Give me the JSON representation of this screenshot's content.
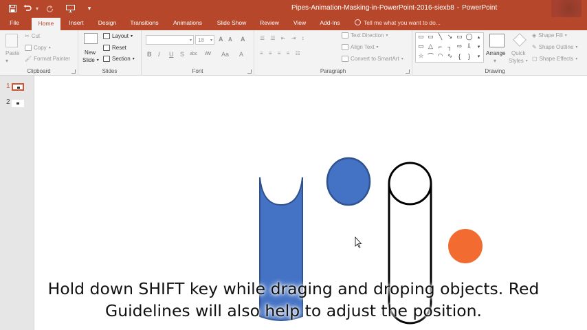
{
  "titlebar": {
    "document_name": "Pipes-Animation-Masking-in-PowerPoint-2016-siexb8",
    "separator": "-",
    "app_name": "PowerPoint",
    "qat": {
      "save_icon": "save-icon",
      "undo_icon": "undo-icon",
      "redo_icon": "redo-icon",
      "present_icon": "present-from-start-icon",
      "customize_icon": "customize-qat-icon"
    }
  },
  "tabs": [
    {
      "label": "File"
    },
    {
      "label": "Home"
    },
    {
      "label": "Insert"
    },
    {
      "label": "Design"
    },
    {
      "label": "Transitions"
    },
    {
      "label": "Animations"
    },
    {
      "label": "Slide Show"
    },
    {
      "label": "Review"
    },
    {
      "label": "View"
    },
    {
      "label": "Add-Ins"
    }
  ],
  "active_tab": "Home",
  "tell_me": "Tell me what you want to do...",
  "ribbon": {
    "clipboard": {
      "label": "Clipboard",
      "paste": "Paste",
      "cut": "Cut",
      "copy": "Copy",
      "format_painter": "Format Painter"
    },
    "slides": {
      "label": "Slides",
      "new_slide": "New",
      "new_slide_2": "Slide",
      "layout": "Layout",
      "reset": "Reset",
      "section": "Section"
    },
    "font": {
      "label": "Font",
      "font_size": "18",
      "bold": "B",
      "italic": "I",
      "underline": "U",
      "strike": "S",
      "shadow": "abc",
      "spacing": "AV",
      "case": "Aa",
      "color": "A",
      "grow": "A",
      "shrink": "A",
      "clear": "A"
    },
    "paragraph": {
      "label": "Paragraph",
      "text_direction": "Text Direction",
      "align_text": "Align Text",
      "smartart": "Convert to SmartArt"
    },
    "drawing": {
      "label": "Drawing",
      "arrange": "Arrange",
      "quick_styles": "Quick",
      "quick_styles_2": "Styles",
      "shape_fill": "Shape Fill",
      "shape_outline": "Shape Outline",
      "shape_effects": "Shape Effects"
    }
  },
  "slides_panel": [
    {
      "number": "1",
      "active": true
    },
    {
      "number": "2",
      "active": false
    }
  ],
  "colors": {
    "accent": "#b7472a",
    "shape_blue": "#4472c4",
    "shape_blue_outline": "#2f528f",
    "shape_orange": "#f26b31"
  },
  "caption": {
    "line1": "Hold down SHIFT key while draging and droping objects. Red",
    "line2": "Guidelines will also help to adjust the position."
  }
}
